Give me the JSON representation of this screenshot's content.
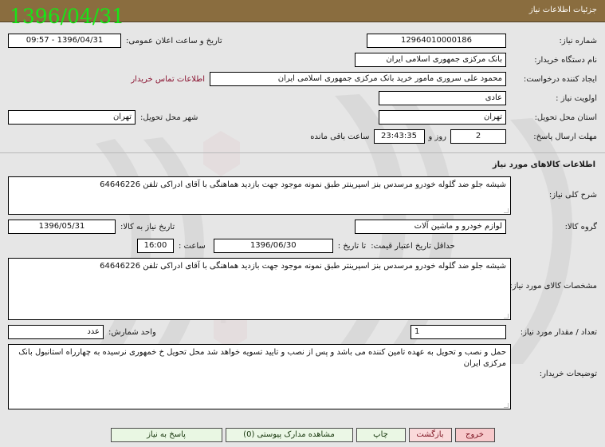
{
  "header": {
    "title": "جزئیات اطلاعات نیاز",
    "date_stamp": "1396/04/31"
  },
  "top_panel": {
    "need_number_label": "شماره نیاز:",
    "need_number_value": "12964010000186",
    "announce_datetime_label": "تاریخ و ساعت اعلان عمومی:",
    "announce_datetime_value": "1396/04/31 - 09:57",
    "buyer_org_label": "نام دستگاه خریدار:",
    "buyer_org_value": "بانک مرکزی جمهوری اسلامی ایران",
    "requester_label": "ایجاد کننده درخواست:",
    "requester_value": "محمود علی سروری مامور خرید بانک مرکزی جمهوری اسلامی ایران",
    "contact_link": "اطلاعات تماس خریدار",
    "priority_label": "اولویت نیاز :",
    "priority_value": "عادی",
    "delivery_province_label": "استان محل تحویل:",
    "delivery_province_value": "تهران",
    "delivery_city_label": "شهر محل تحویل:",
    "delivery_city_value": "تهران",
    "deadline_label": "مهلت ارسال پاسخ:",
    "deadline_days": "2",
    "deadline_days_unit": "روز و",
    "deadline_time": "23:43:35",
    "deadline_suffix": "ساعت باقی مانده"
  },
  "goods_panel": {
    "section_title": "اطلاعات کالاهای مورد نیاز",
    "general_desc_label": "شرح کلی نیاز:",
    "general_desc_value": "شیشه جلو ضد گلوله خودرو مرسدس بنز اسپرینتر طبق نمونه موجود جهت بازدید هماهنگی با آقای ادراکی تلفن 64646226",
    "goods_group_label": "گروه کالا:",
    "goods_group_value": "لوازم خودرو و ماشین آلات",
    "need_date_label": "تاریخ نیاز به کالا:",
    "need_date_value": "1396/05/31",
    "price_validity_label": "حداقل تاریخ اعتبار قیمت:",
    "price_validity_until_label": "تا تاریخ :",
    "price_validity_date": "1396/06/30",
    "price_validity_time_label": "ساعت :",
    "price_validity_time": "16:00",
    "specs_label": "مشخصات کالای مورد نیاز:",
    "specs_value": "شیشه جلو ضد گلوله خودرو مرسدس بنز اسپرینتر طبق نمونه موجود جهت بازدید هماهنگی با آقای ادراکی تلفن 64646226",
    "quantity_label": "تعداد / مقدار مورد نیاز:",
    "quantity_value": "1",
    "unit_label": "واحد شمارش:",
    "unit_value": "عدد",
    "buyer_notes_label": "توضیحات خریدار:",
    "buyer_notes_value": "حمل و نصب و تحویل به عهده تامین کننده می باشد و پس از نصب و تایید تسویه خواهد شد محل تحویل خ خمهوری نرسیده به چهارراه استانبول بانک مرکزی ایران"
  },
  "footer": {
    "respond_button": "پاسخ به نیاز",
    "attachments_button": "مشاهده مدارک پیوستی (0)",
    "print_button": "چاپ",
    "back_button": "بازگشت",
    "exit_button": "خروج"
  },
  "colors": {
    "header_bg": "#8a6d3f",
    "date_stamp": "#17e617",
    "link": "#8a1230",
    "green_button": "#e9f7e3",
    "pink_button": "#fadadb"
  }
}
